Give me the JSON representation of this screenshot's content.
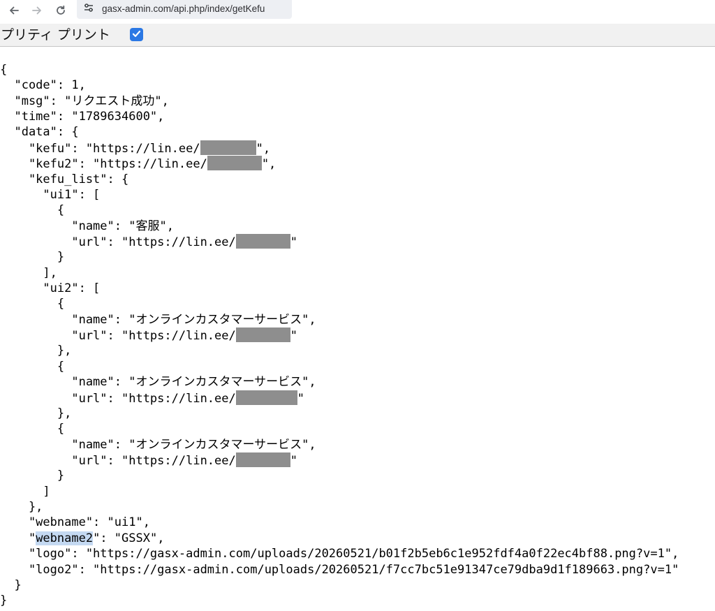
{
  "browser": {
    "url": "gasx-admin.com/api.php/index/getKefu",
    "back_icon": "arrow-left-icon",
    "forward_icon": "arrow-right-icon",
    "reload_icon": "reload-icon",
    "site_info_icon": "tune-icon"
  },
  "pretty_print": {
    "label": "プリティ プリント",
    "checked": true,
    "accent_color": "#2b78e4"
  },
  "json": {
    "open_brace": "{",
    "code_line": "  \"code\": 1,",
    "msg_key": "  \"msg\": ",
    "msg_value": "\"リクエスト成功\",",
    "time_line": "  \"time\": \"1789634600\",",
    "data_open": "  \"data\": {",
    "kefu_prefix": "    \"kefu\": \"https://lin.ee/",
    "kefu_suffix": "\",",
    "kefu2_prefix": "    \"kefu2\": \"https://lin.ee/",
    "kefu2_suffix": "\",",
    "kefu_list_open": "    \"kefu_list\": {",
    "ui1_open": "      \"ui1\": [",
    "ui1_items": [
      {
        "name": "客服"
      }
    ],
    "ui1_close": "      ],",
    "ui2_open": "      \"ui2\": [",
    "ui2_items": [
      {
        "name": "オンラインカスタマーサービス"
      },
      {
        "name": "オンラインカスタマーサービス"
      },
      {
        "name": "オンラインカスタマーサービス"
      }
    ],
    "ui2_close": "      ]",
    "kefu_list_close": "    },",
    "obj_open": "        {",
    "obj_close": "        }",
    "obj_close_comma": "        },",
    "name_key": "          \"name\": ",
    "url_prefix": "          \"url\": \"https://lin.ee/",
    "url_suffix": "\"",
    "webname_line": "    \"webname\": \"ui1\",",
    "webname2_indent": "    \"",
    "webname2_key": "webname2",
    "webname2_rest": "\": \"GSSX\",",
    "logo_line": "    \"logo\": \"https://gasx-admin.com/uploads/20260521/b01f2b5eb6c1e952fdf4a0f22ec4bf88.png?v=1\",",
    "logo2_line": "    \"logo2\": \"https://gasx-admin.com/uploads/20260521/f7cc7bc51e91347ce79dba9d1f189663.png?v=1\"",
    "data_close": "  }",
    "close_brace": "}"
  }
}
